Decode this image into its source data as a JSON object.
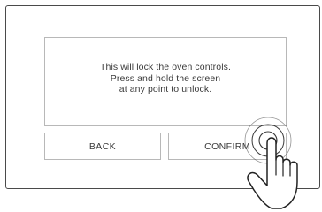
{
  "dialog": {
    "message_line1": "This will lock the oven controls.",
    "message_line2": "Press and hold the screen",
    "message_line3": "at any point to unlock."
  },
  "buttons": {
    "back_label": "BACK",
    "confirm_label": "CONFIRM"
  },
  "gesture": {
    "icon": "press-and-hold-hand-icon"
  },
  "colors": {
    "frame": "#4a4a4a",
    "border": "#b8b8b8",
    "text": "#3a3a3a"
  }
}
